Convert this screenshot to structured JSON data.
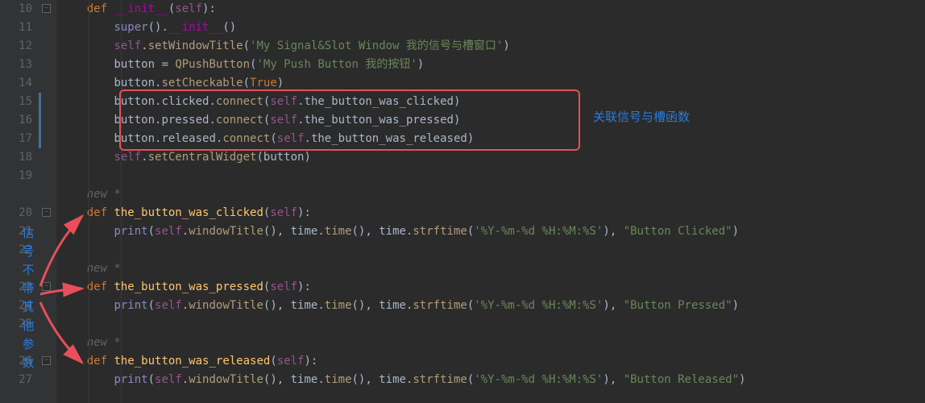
{
  "gutter": {
    "start": 10,
    "lines": [
      10,
      11,
      12,
      13,
      14,
      15,
      16,
      17,
      18,
      19,
      "",
      20,
      21,
      22,
      "",
      23,
      24,
      25,
      "",
      26,
      27
    ]
  },
  "hints": {
    "new_star": "new *"
  },
  "code": {
    "l10": {
      "kw": "def",
      "name": "__init__",
      "self": "self"
    },
    "l11": {
      "super": "super",
      "init": "__init__"
    },
    "l12": {
      "self": "self",
      "m": "setWindowTitle",
      "s": "'My Signal&Slot Window 我的信号与槽窗口'"
    },
    "l13": {
      "v": "button",
      "cls": "QPushButton",
      "s": "'My Push Button 我的按钮'"
    },
    "l14": {
      "v": "button",
      "m": "setCheckable",
      "t": "True"
    },
    "l15": {
      "v": "button",
      "sig": "clicked",
      "m": "connect",
      "self": "self",
      "slot": "the_button_was_clicked"
    },
    "l16": {
      "v": "button",
      "sig": "pressed",
      "m": "connect",
      "self": "self",
      "slot": "the_button_was_pressed"
    },
    "l17": {
      "v": "button",
      "sig": "released",
      "m": "connect",
      "self": "self",
      "slot": "the_button_was_released"
    },
    "l18": {
      "self": "self",
      "m": "setCentralWidget",
      "a": "button"
    },
    "l20": {
      "kw": "def",
      "name": "the_button_was_clicked",
      "self": "self"
    },
    "l21": {
      "p": "print",
      "self": "self",
      "wt": "windowTitle",
      "t1": "time",
      "m1": "time",
      "t2": "time",
      "m2": "strftime",
      "fmt": "'%Y-%m-%d %H:%M:%S'",
      "msg": "\"Button Clicked\""
    },
    "l23": {
      "kw": "def",
      "name": "the_button_was_pressed",
      "self": "self"
    },
    "l24": {
      "p": "print",
      "self": "self",
      "wt": "windowTitle",
      "t1": "time",
      "m1": "time",
      "t2": "time",
      "m2": "strftime",
      "fmt": "'%Y-%m-%d %H:%M:%S'",
      "msg": "\"Button Pressed\""
    },
    "l26": {
      "kw": "def",
      "name": "the_button_was_released",
      "self": "self"
    },
    "l27": {
      "p": "print",
      "self": "self",
      "wt": "windowTitle",
      "t1": "time",
      "m1": "time",
      "t2": "time",
      "m2": "strftime",
      "fmt": "'%Y-%m-%d %H:%M:%S'",
      "msg": "\"Button Released\""
    }
  },
  "annotations": {
    "right_label": "关联信号与槽函数",
    "left_vertical": [
      "信",
      "号",
      "不",
      "带",
      "其",
      "他",
      "参",
      "数"
    ]
  }
}
